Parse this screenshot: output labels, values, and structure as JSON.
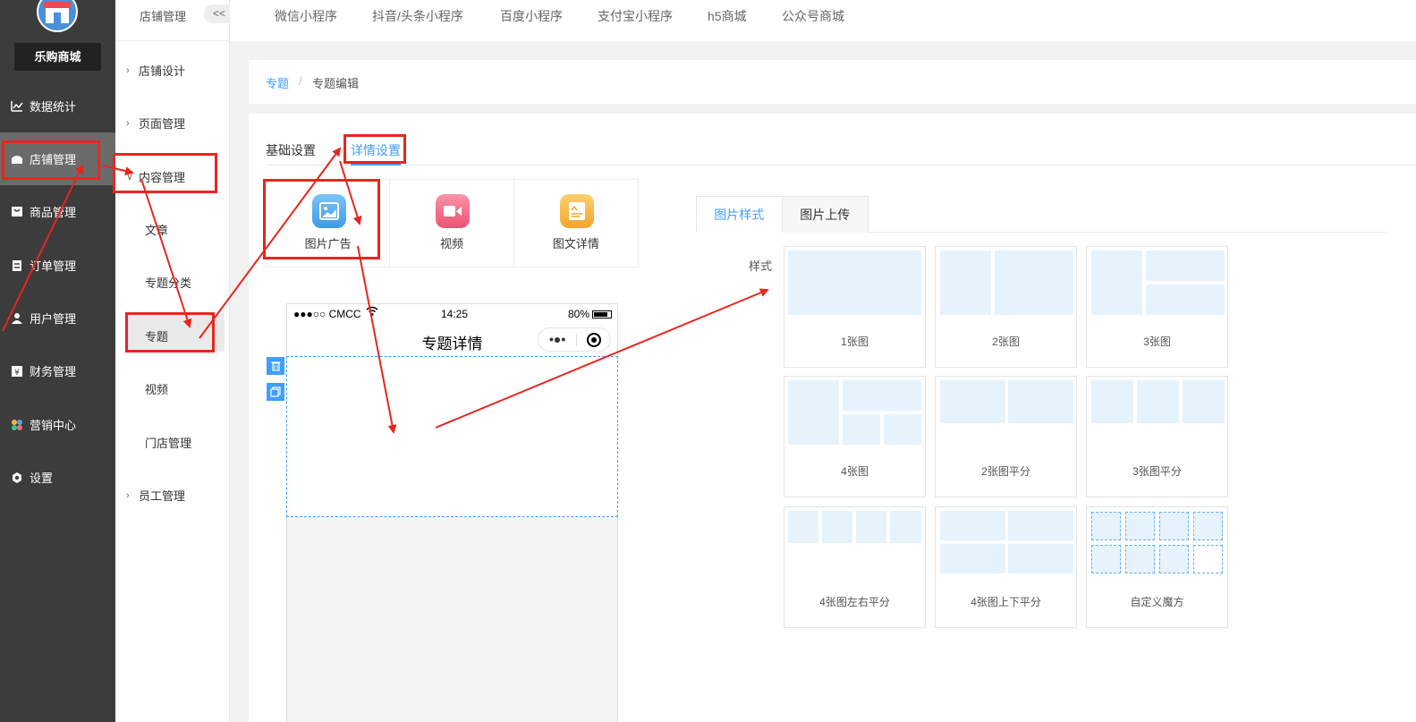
{
  "brand": {
    "name": "乐购商城",
    "logo_icon": "store-icon"
  },
  "sidebar": {
    "items": [
      {
        "label": "数据统计",
        "icon": "chart-icon"
      },
      {
        "label": "店铺管理",
        "icon": "shop-icon",
        "active": true
      },
      {
        "label": "商品管理",
        "icon": "goods-icon"
      },
      {
        "label": "订单管理",
        "icon": "order-icon"
      },
      {
        "label": "用户管理",
        "icon": "user-icon"
      },
      {
        "label": "财务管理",
        "icon": "finance-icon"
      },
      {
        "label": "营销中心",
        "icon": "marketing-icon"
      },
      {
        "label": "设置",
        "icon": "settings-icon"
      }
    ]
  },
  "submenu": {
    "title": "店铺管理",
    "collapse_label": "<<",
    "items": [
      {
        "label": "店铺设计"
      },
      {
        "label": "页面管理"
      },
      {
        "label": "内容管理",
        "expanded": true,
        "children": [
          "文章",
          "专题分类",
          "专题",
          "视频",
          "门店管理"
        ]
      },
      {
        "label": "员工管理"
      }
    ]
  },
  "top_tabs": [
    "微信小程序",
    "抖音/头条小程序",
    "百度小程序",
    "支付宝小程序",
    "h5商城",
    "公众号商城"
  ],
  "breadcrumb": {
    "parent": "专题",
    "separator": "/",
    "current": "专题编辑"
  },
  "tabs": {
    "basic": "基础设置",
    "detail": "详情设置",
    "active": "detail"
  },
  "components": [
    {
      "label": "图片广告",
      "icon": "image-ad-icon",
      "color": "#4aa8f0"
    },
    {
      "label": "视频",
      "icon": "video-icon",
      "color": "#f06a84"
    },
    {
      "label": "图文详情",
      "icon": "article-icon",
      "color": "#f5b43c"
    }
  ],
  "phone": {
    "carrier": "●●●○○ CMCC",
    "time": "14:25",
    "battery": "80%",
    "battery_level": 0.8,
    "title": "专题详情",
    "menu_glyph": "•●•"
  },
  "right_panel": {
    "tabs": [
      "图片样式",
      "图片上传"
    ],
    "active_tab": "图片样式",
    "style_label": "样式",
    "styles": [
      "1张图",
      "2张图",
      "3张图",
      "4张图",
      "2张图平分",
      "3张图平分",
      "4张图左右平分",
      "4张图上下平分",
      "自定义魔方"
    ]
  },
  "colors": {
    "accent": "#409eff",
    "annotation": "#e8261e",
    "sidebar_bg": "#3c3c3c",
    "tile_fill": "#e6f3fd"
  }
}
